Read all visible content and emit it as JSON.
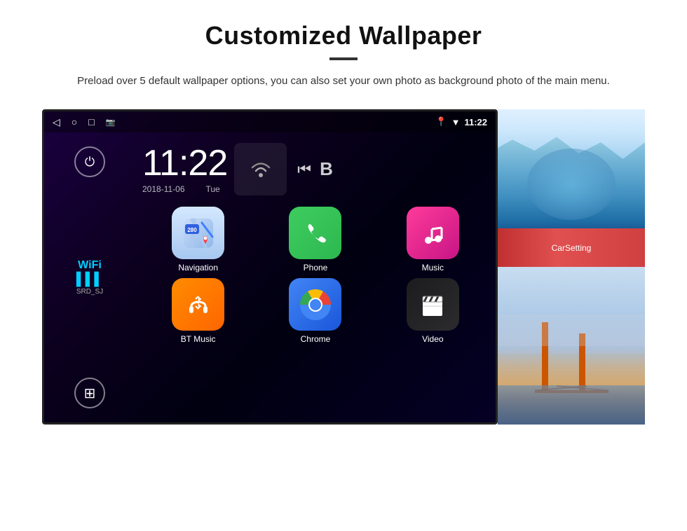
{
  "page": {
    "title": "Customized Wallpaper",
    "description": "Preload over 5 default wallpaper options, you can also set your own photo as background photo of the main menu."
  },
  "android": {
    "statusBar": {
      "time": "11:22",
      "icons": [
        "◁",
        "○",
        "□",
        "📷"
      ]
    },
    "clock": {
      "time": "11:22",
      "date": "2018-11-06",
      "day": "Tue"
    },
    "wifi": {
      "label": "WiFi",
      "ssid": "SRD_SJ"
    },
    "apps": [
      {
        "name": "Navigation",
        "type": "nav"
      },
      {
        "name": "Phone",
        "type": "phone"
      },
      {
        "name": "Music",
        "type": "music"
      },
      {
        "name": "BT Music",
        "type": "bt"
      },
      {
        "name": "Chrome",
        "type": "chrome"
      },
      {
        "name": "Video",
        "type": "video"
      }
    ],
    "wallpapers": [
      {
        "name": "ice-cave",
        "label": "Ice Cave"
      },
      {
        "name": "golden-gate",
        "label": "Golden Gate"
      }
    ],
    "carSetting": "CarSetting"
  },
  "icons": {
    "back": "◁",
    "home": "○",
    "recent": "□",
    "camera": "⬛",
    "location": "📍",
    "signal": "▼",
    "wifi_symbol": "WiFi",
    "power": "⏻",
    "grid": "⊞",
    "skip_prev": "⏮",
    "bluetooth": "B"
  }
}
